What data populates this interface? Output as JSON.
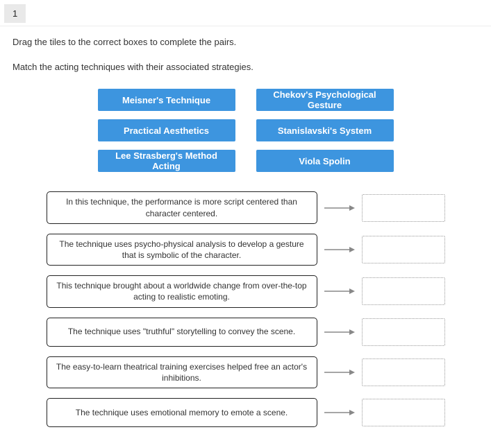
{
  "question_number": "1",
  "instruction_line1": "Drag the tiles to the correct boxes to complete the pairs.",
  "instruction_line2": "Match the acting techniques with their associated strategies.",
  "tile_rows": [
    [
      "Meisner's Technique",
      "Chekov's Psychological Gesture"
    ],
    [
      "Practical Aesthetics",
      "Stanislavski's System"
    ],
    [
      "Lee Strasberg's Method Acting",
      "Viola Spolin"
    ]
  ],
  "descriptions": [
    "In this technique, the performance is more script centered than character centered.",
    "The technique uses psycho-physical analysis to develop a gesture that is symbolic of the character.",
    "This technique brought about a worldwide change from over-the-top acting to realistic emoting.",
    "The technique uses \"truthful\" storytelling to convey the scene.",
    "The easy-to-learn theatrical training exercises helped free an actor's inhibitions.",
    "The technique uses emotional memory to emote a scene."
  ]
}
